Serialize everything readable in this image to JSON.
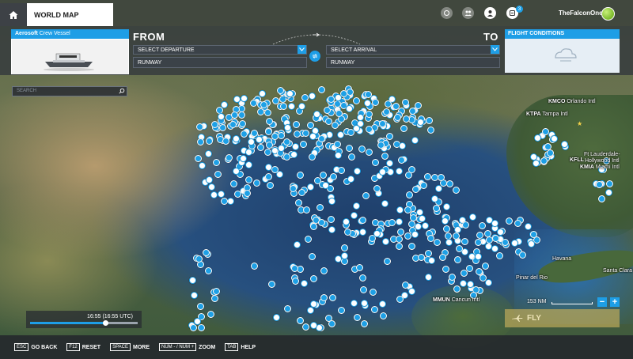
{
  "header": {
    "world_map_label": "WORLD MAP",
    "username": "TheFalconOne",
    "notification_count": "3"
  },
  "vehicle": {
    "brand": "Aerosoft",
    "name": "Crew Vessel"
  },
  "flight": {
    "from_label": "FROM",
    "to_label": "TO",
    "departure_placeholder": "SELECT DEPARTURE",
    "arrival_placeholder": "SELECT ARRIVAL",
    "departure_runway": "RUNWAY",
    "arrival_runway": "RUNWAY"
  },
  "conditions": {
    "title": "FLIGHT CONDITIONS"
  },
  "search": {
    "placeholder": "SEARCH"
  },
  "map_labels": {
    "kmco": "KMCO",
    "orlando": "Orlando Intl",
    "ktpa": "KTPA",
    "tampa": "Tampa Intl",
    "ftl": "Ft Lauderdale-",
    "hollywood": "Hollywood Intl",
    "kfll": "KFLL",
    "kmia": "KMIA",
    "miami": "Miami Intl",
    "havana": "Havana",
    "santa_clara": "Santa Clara",
    "pinar": "Pinar del Rio",
    "mmun": "MMUN",
    "cancun": "Cancun Intl"
  },
  "time": {
    "label": "16:55 (16:55 UTC)",
    "progress": 0.7
  },
  "scale": {
    "label": "153 NM"
  },
  "fly_button": {
    "label": "FLY"
  },
  "bottom_bar": [
    {
      "key": "ESC",
      "label": "GO BACK"
    },
    {
      "key": "F12",
      "label": "RESET"
    },
    {
      "key": "SPACE",
      "label": "MORE"
    },
    {
      "key": "NUM - / NUM +",
      "label": "ZOOM"
    },
    {
      "key": "TAB",
      "label": "HELP"
    }
  ],
  "colors": {
    "accent": "#1e9ee6",
    "fly_button": "#beaa5a"
  }
}
